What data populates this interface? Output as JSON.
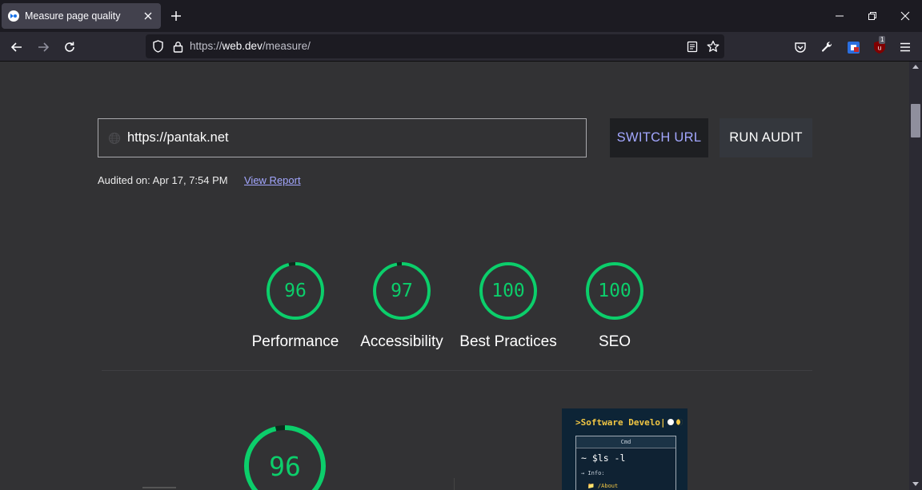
{
  "browser": {
    "tab_title": "Measure page quality",
    "new_tab_label": "+",
    "url_scheme": "https://",
    "url_host": "web.dev",
    "url_path": "/measure/",
    "extension_badge": "1"
  },
  "audit": {
    "url_value": "https://pantak.net",
    "switch_url_label": "SWITCH URL",
    "run_audit_label": "RUN AUDIT",
    "audited_on": "Audited on: Apr 17, 7:54 PM",
    "view_report_label": "View Report"
  },
  "scores": [
    {
      "value": "96",
      "label": "Performance",
      "fraction": 0.96
    },
    {
      "value": "97",
      "label": "Accessibility",
      "fraction": 0.97
    },
    {
      "value": "100",
      "label": "Best Practices",
      "fraction": 1.0
    },
    {
      "value": "100",
      "label": "SEO",
      "fraction": 1.0
    }
  ],
  "detail_score": {
    "value": "96",
    "fraction": 0.96
  },
  "preview": {
    "title": ">Software Develo|",
    "terminal_header": "Cmd",
    "terminal_command": "~ $ls -l",
    "terminal_info": "→ Info:",
    "terminal_about": "📁 /About"
  },
  "colors": {
    "score_good": "#0cce6b",
    "accent_link": "#a3a7ff",
    "page_bg": "#323234"
  },
  "icons": [
    "back-icon",
    "forward-icon",
    "reload-icon",
    "shield-icon",
    "lock-icon",
    "reader-view-icon",
    "bookmark-star-icon",
    "pocket-icon",
    "wrench-icon",
    "container-icon",
    "ublock-icon",
    "menu-icon",
    "globe-icon"
  ]
}
